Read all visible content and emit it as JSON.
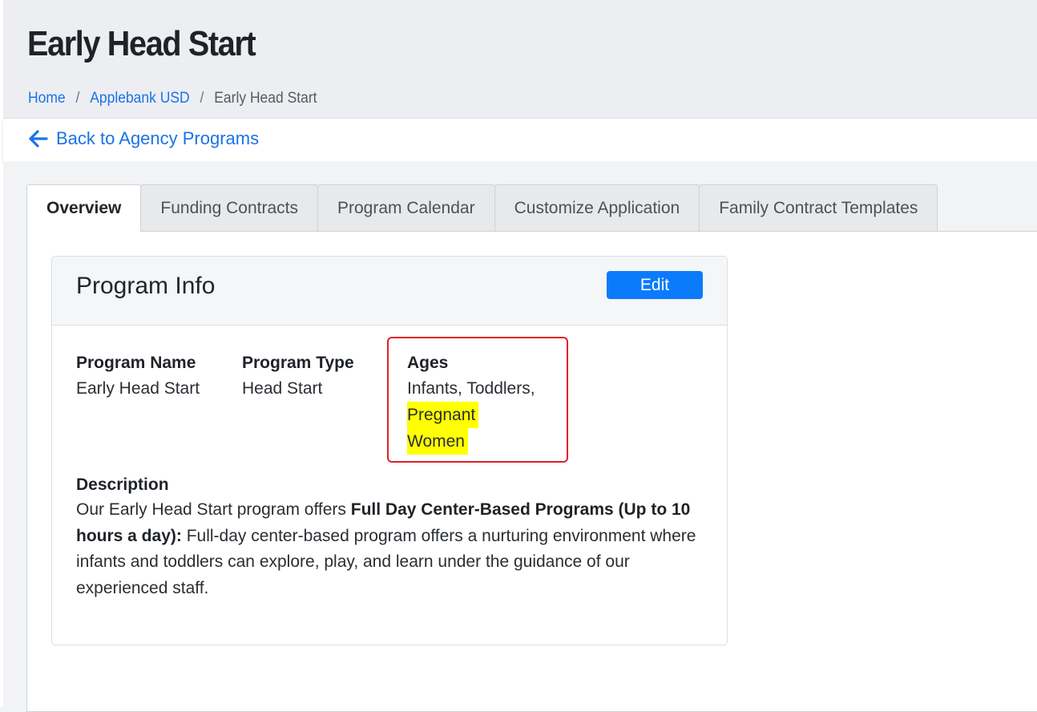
{
  "header": {
    "title": "Early Head Start",
    "breadcrumb": [
      {
        "label": "Home"
      },
      {
        "label": "Applebank USD"
      },
      {
        "label": "Early Head Start"
      }
    ],
    "separator": "/"
  },
  "back_link": {
    "icon": "arrow-left-icon",
    "label": "Back to Agency Programs"
  },
  "tabs": [
    {
      "label": "Overview",
      "active": true
    },
    {
      "label": "Funding Contracts",
      "active": false
    },
    {
      "label": "Program Calendar",
      "active": false
    },
    {
      "label": "Customize Application",
      "active": false
    },
    {
      "label": "Family Contract Templates",
      "active": false
    }
  ],
  "program_info": {
    "title": "Program Info",
    "edit_label": "Edit",
    "program_name": {
      "label": "Program Name",
      "value": "Early Head Start"
    },
    "program_type": {
      "label": "Program Type",
      "value": "Head Start"
    },
    "ages": {
      "label": "Ages",
      "value_line1": "Infants, Toddlers,",
      "value_hl_line1": "Pregnant",
      "value_hl_line2": "Women"
    },
    "description": {
      "label": "Description",
      "text_intro": "Our Early Head Start program offers ",
      "text_bold": "Full Day Center-Based Programs (Up to 10 hours a day):",
      "text_rest": " Full-day center-based program offers a nurturing environment where infants and toddlers can explore, play, and learn under the guidance of our experienced staff."
    }
  },
  "colors": {
    "link": "#1a73e8",
    "primary_button": "#0b7bfb",
    "highlight": "#ffff00",
    "annotation_box": "#e0202a"
  }
}
